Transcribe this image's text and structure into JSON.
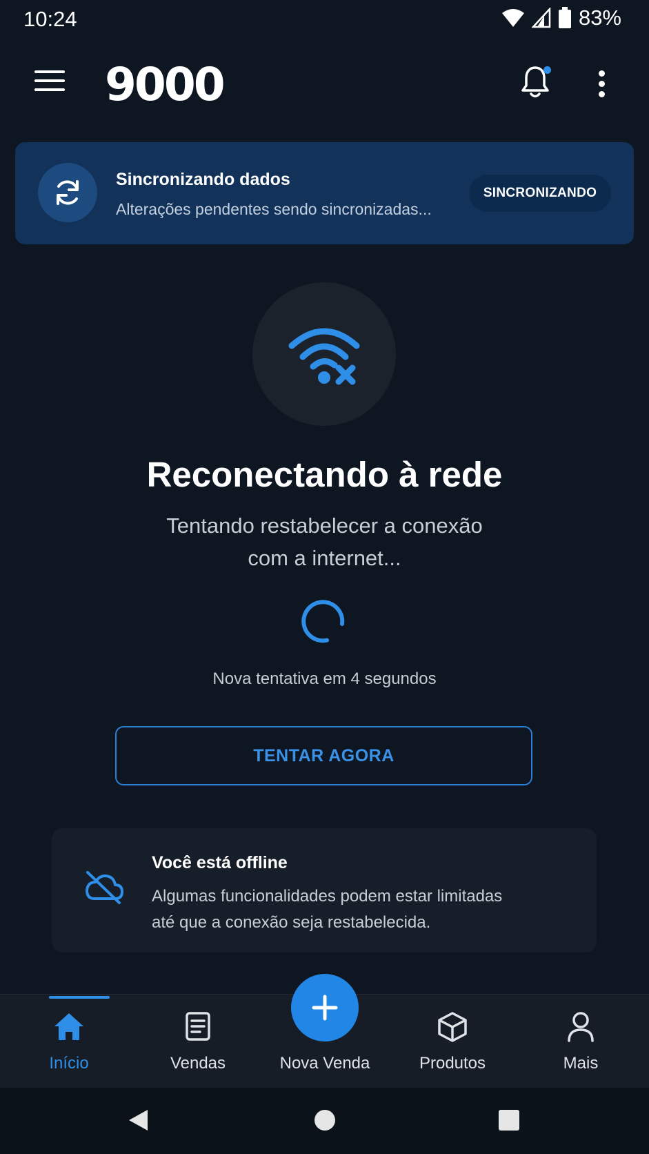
{
  "status_bar": {
    "time": "10:24",
    "battery_percent": "83%"
  },
  "app_bar": {
    "logo": "9000",
    "notification_dot_color": "#2f8fe8"
  },
  "sync_banner": {
    "title": "Sincronizando dados",
    "subtitle": "Alterações pendentes sendo sincronizadas...",
    "status_pill": "SINCRONIZANDO"
  },
  "connection": {
    "title": "Reconectando à rede",
    "subtitle_line1": "Tentando restabelecer a conexão",
    "subtitle_line2": "com a internet...",
    "retry_countdown": "Nova tentativa em 4 segundos",
    "retry_button": "TENTAR AGORA"
  },
  "offline_card": {
    "title": "Você está offline",
    "text_line1": "Algumas funcionalidades podem estar limitadas",
    "text_line2": "até que a conexão seja restabelecida."
  },
  "bottom_nav": {
    "items": [
      {
        "label": "Início",
        "icon": "home-icon",
        "active": true
      },
      {
        "label": "Vendas",
        "icon": "receipt-icon",
        "active": false
      },
      {
        "label": "Nova Venda",
        "icon": "plus-icon",
        "active": false
      },
      {
        "label": "Produtos",
        "icon": "box-icon",
        "active": false
      },
      {
        "label": "Mais",
        "icon": "person-icon",
        "active": false
      }
    ]
  },
  "colors": {
    "accent": "#2f8fe8",
    "background": "#0e1621",
    "banner": "#12325a"
  }
}
